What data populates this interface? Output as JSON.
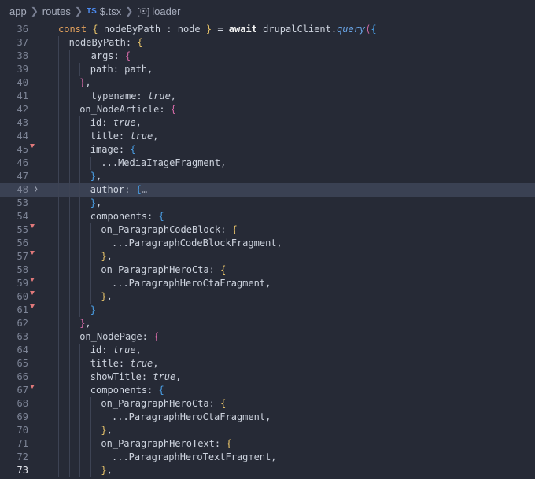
{
  "breadcrumb": {
    "items": [
      {
        "label": "app"
      },
      {
        "label": "routes"
      },
      {
        "prefix": "TS",
        "label": "$.tsx"
      },
      {
        "label": "loader"
      }
    ]
  },
  "editor": {
    "lines": [
      {
        "n": "36",
        "indent": 1,
        "tokens": [
          [
            "t-kw",
            "const "
          ],
          [
            "t-br1",
            "{ "
          ],
          [
            "",
            "nodeByPath : node "
          ],
          [
            "t-br1",
            "}"
          ],
          [
            "",
            " = "
          ],
          [
            "t-kw2",
            "await"
          ],
          [
            "",
            " drupalClient."
          ],
          [
            "t-fn",
            "query"
          ],
          [
            "t-br2",
            "("
          ],
          [
            "t-br3",
            "{"
          ]
        ]
      },
      {
        "n": "37",
        "indent": 2,
        "tokens": [
          [
            "",
            "nodeByPath: "
          ],
          [
            "t-br1",
            "{"
          ]
        ]
      },
      {
        "n": "38",
        "indent": 3,
        "tokens": [
          [
            "",
            "__args: "
          ],
          [
            "t-br2",
            "{"
          ]
        ]
      },
      {
        "n": "39",
        "indent": 4,
        "tokens": [
          [
            "",
            "path: path,"
          ]
        ]
      },
      {
        "n": "40",
        "indent": 3,
        "tokens": [
          [
            "t-br2",
            "}"
          ],
          [
            "",
            ","
          ]
        ]
      },
      {
        "n": "41",
        "indent": 3,
        "tokens": [
          [
            "",
            "__typename: "
          ],
          [
            "t-bool",
            "true"
          ],
          [
            "",
            ","
          ]
        ]
      },
      {
        "n": "42",
        "indent": 3,
        "tokens": [
          [
            "",
            "on_NodeArticle: "
          ],
          [
            "t-br2",
            "{"
          ]
        ]
      },
      {
        "n": "43",
        "indent": 4,
        "tokens": [
          [
            "",
            "id: "
          ],
          [
            "t-bool",
            "true"
          ],
          [
            "",
            ","
          ]
        ]
      },
      {
        "n": "44",
        "indent": 4,
        "tokens": [
          [
            "",
            "title: "
          ],
          [
            "t-bool",
            "true"
          ],
          [
            "",
            ","
          ]
        ]
      },
      {
        "n": "45",
        "indent": 4,
        "marker": true,
        "tokens": [
          [
            "",
            "image: "
          ],
          [
            "t-br3",
            "{"
          ]
        ]
      },
      {
        "n": "46",
        "indent": 5,
        "tokens": [
          [
            "",
            "...MediaImageFragment,"
          ]
        ]
      },
      {
        "n": "47",
        "indent": 4,
        "tokens": [
          [
            "t-br3",
            "}"
          ],
          [
            "",
            ","
          ]
        ]
      },
      {
        "n": "48",
        "indent": 4,
        "fold": true,
        "tokens": [
          [
            "",
            "author: "
          ],
          [
            "t-br3",
            "{"
          ],
          [
            "t-dim",
            "…"
          ]
        ]
      },
      {
        "n": "53",
        "indent": 4,
        "tokens": [
          [
            "t-br3",
            "}"
          ],
          [
            "",
            ","
          ]
        ]
      },
      {
        "n": "54",
        "indent": 4,
        "tokens": [
          [
            "",
            "components: "
          ],
          [
            "t-br3",
            "{"
          ]
        ]
      },
      {
        "n": "55",
        "indent": 5,
        "marker": true,
        "tokens": [
          [
            "",
            "on_ParagraphCodeBlock: "
          ],
          [
            "t-br1",
            "{"
          ]
        ]
      },
      {
        "n": "56",
        "indent": 6,
        "tokens": [
          [
            "",
            "...ParagraphCodeBlockFragment,"
          ]
        ]
      },
      {
        "n": "57",
        "indent": 5,
        "marker": true,
        "tokens": [
          [
            "t-br1",
            "}"
          ],
          [
            "",
            ","
          ]
        ]
      },
      {
        "n": "58",
        "indent": 5,
        "tokens": [
          [
            "",
            "on_ParagraphHeroCta: "
          ],
          [
            "t-br1",
            "{"
          ]
        ]
      },
      {
        "n": "59",
        "indent": 6,
        "marker": true,
        "tokens": [
          [
            "",
            "...ParagraphHeroCtaFragment,"
          ]
        ]
      },
      {
        "n": "60",
        "indent": 5,
        "marker": true,
        "tokens": [
          [
            "t-br1",
            "}"
          ],
          [
            "",
            ","
          ]
        ]
      },
      {
        "n": "61",
        "indent": 4,
        "marker": true,
        "tokens": [
          [
            "t-br3",
            "}"
          ]
        ]
      },
      {
        "n": "62",
        "indent": 3,
        "tokens": [
          [
            "t-br2",
            "}"
          ],
          [
            "",
            ","
          ]
        ]
      },
      {
        "n": "63",
        "indent": 3,
        "tokens": [
          [
            "",
            "on_NodePage: "
          ],
          [
            "t-br2",
            "{"
          ]
        ]
      },
      {
        "n": "64",
        "indent": 4,
        "tokens": [
          [
            "",
            "id: "
          ],
          [
            "t-bool",
            "true"
          ],
          [
            "",
            ","
          ]
        ]
      },
      {
        "n": "65",
        "indent": 4,
        "tokens": [
          [
            "",
            "title: "
          ],
          [
            "t-bool",
            "true"
          ],
          [
            "",
            ","
          ]
        ]
      },
      {
        "n": "66",
        "indent": 4,
        "tokens": [
          [
            "",
            "showTitle: "
          ],
          [
            "t-bool",
            "true"
          ],
          [
            "",
            ","
          ]
        ]
      },
      {
        "n": "67",
        "indent": 4,
        "marker": true,
        "tokens": [
          [
            "",
            "components: "
          ],
          [
            "t-br3",
            "{"
          ]
        ]
      },
      {
        "n": "68",
        "indent": 5,
        "tokens": [
          [
            "",
            "on_ParagraphHeroCta: "
          ],
          [
            "t-br1",
            "{"
          ]
        ]
      },
      {
        "n": "69",
        "indent": 6,
        "tokens": [
          [
            "",
            "...ParagraphHeroCtaFragment,"
          ]
        ]
      },
      {
        "n": "70",
        "indent": 5,
        "tokens": [
          [
            "t-br1",
            "}"
          ],
          [
            "",
            ","
          ]
        ]
      },
      {
        "n": "71",
        "indent": 5,
        "tokens": [
          [
            "",
            "on_ParagraphHeroText: "
          ],
          [
            "t-br1",
            "{"
          ]
        ]
      },
      {
        "n": "72",
        "indent": 6,
        "tokens": [
          [
            "",
            "...ParagraphHeroTextFragment,"
          ]
        ]
      },
      {
        "n": "73",
        "indent": 5,
        "current": true,
        "tokens": [
          [
            "t-br1",
            "}"
          ],
          [
            "",
            ","
          ]
        ]
      }
    ]
  }
}
